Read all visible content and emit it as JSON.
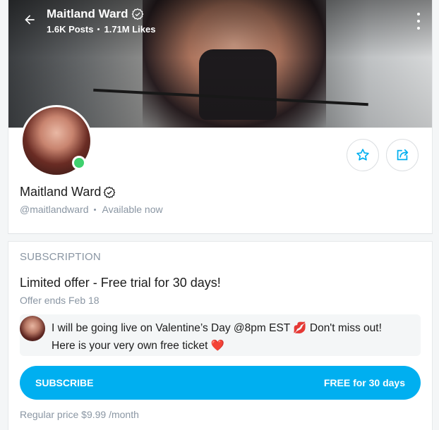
{
  "header": {
    "name": "Maitland Ward",
    "posts": "1.6K Posts",
    "likes": "1.71M Likes"
  },
  "profile": {
    "name": "Maitland Ward",
    "handle": "@maitlandward",
    "status": "Available now"
  },
  "subscription": {
    "section_title": "SUBSCRIPTION",
    "offer_title": "Limited offer - Free trial for 30 days!",
    "offer_ends": "Offer ends Feb 18",
    "message_line1": "I will be going live on Valentine’s Day @8pm EST 💋 Don't miss out!",
    "message_line2": "Here is your very own free ticket ❤️",
    "subscribe_label": "SUBSCRIBE",
    "subscribe_price": "FREE for 30 days",
    "regular_price": "Regular price $9.99 /month"
  },
  "colors": {
    "accent": "#00aff0",
    "online": "#3fd16e",
    "muted": "#8a96a3"
  },
  "icons": [
    "back-arrow-icon",
    "verified-icon",
    "more-vertical-icon",
    "star-icon",
    "share-icon"
  ]
}
